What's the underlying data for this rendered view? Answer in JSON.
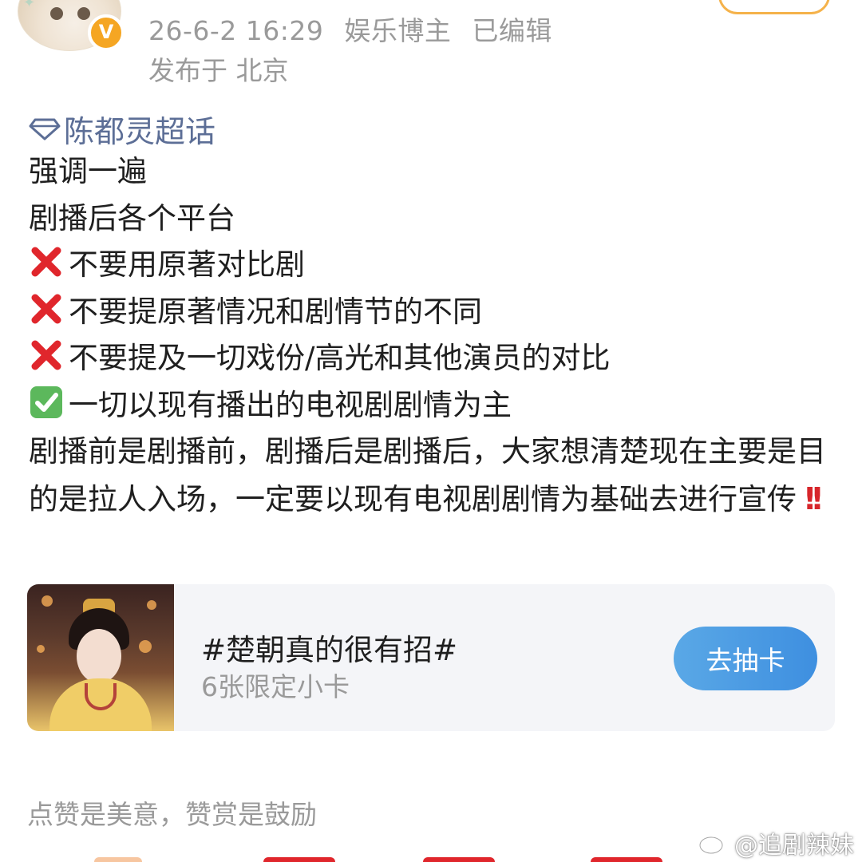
{
  "header": {
    "timestamp": "26-6-2 16:29",
    "role": "娱乐博主",
    "edited": "已编辑",
    "location": "发布于 北京"
  },
  "post": {
    "topic": "陈都灵超话",
    "lines": [
      "强调一遍",
      "剧播后各个平台",
      "不要用原著对比剧",
      "不要提原著情况和剧情节的不同",
      "不要提及一切戏份/高光和其他演员的对比",
      "一切以现有播出的电视剧剧情为主",
      "剧播前是剧播前，剧播后是剧播后，大家想清楚现在主要是目的是拉人入场，一定要以现有电视剧剧情为基础去进行宣传"
    ]
  },
  "card": {
    "title": "#楚朝真的很有招#",
    "subtitle": "6张限定小卡",
    "button": "去抽卡"
  },
  "footer": {
    "tip": "点赞是美意，赞赏是鼓励",
    "watermark": "@追剧辣妹"
  },
  "colors": {
    "meta_gray": "#9a9a9a",
    "topic_blue": "#5c6e96",
    "verify_orange": "#f5a623",
    "button_blue": "#3e8fe0",
    "card_bg": "#f4f5f8",
    "cross_red": "#e0262c",
    "check_green": "#5cb85c"
  },
  "icons": {
    "topic": "diamond-icon",
    "verify": "verified-badge-icon",
    "cross": "cross-mark-icon",
    "check": "check-mark-icon",
    "alert": "double-exclamation-icon",
    "weibo": "weibo-logo-icon"
  }
}
